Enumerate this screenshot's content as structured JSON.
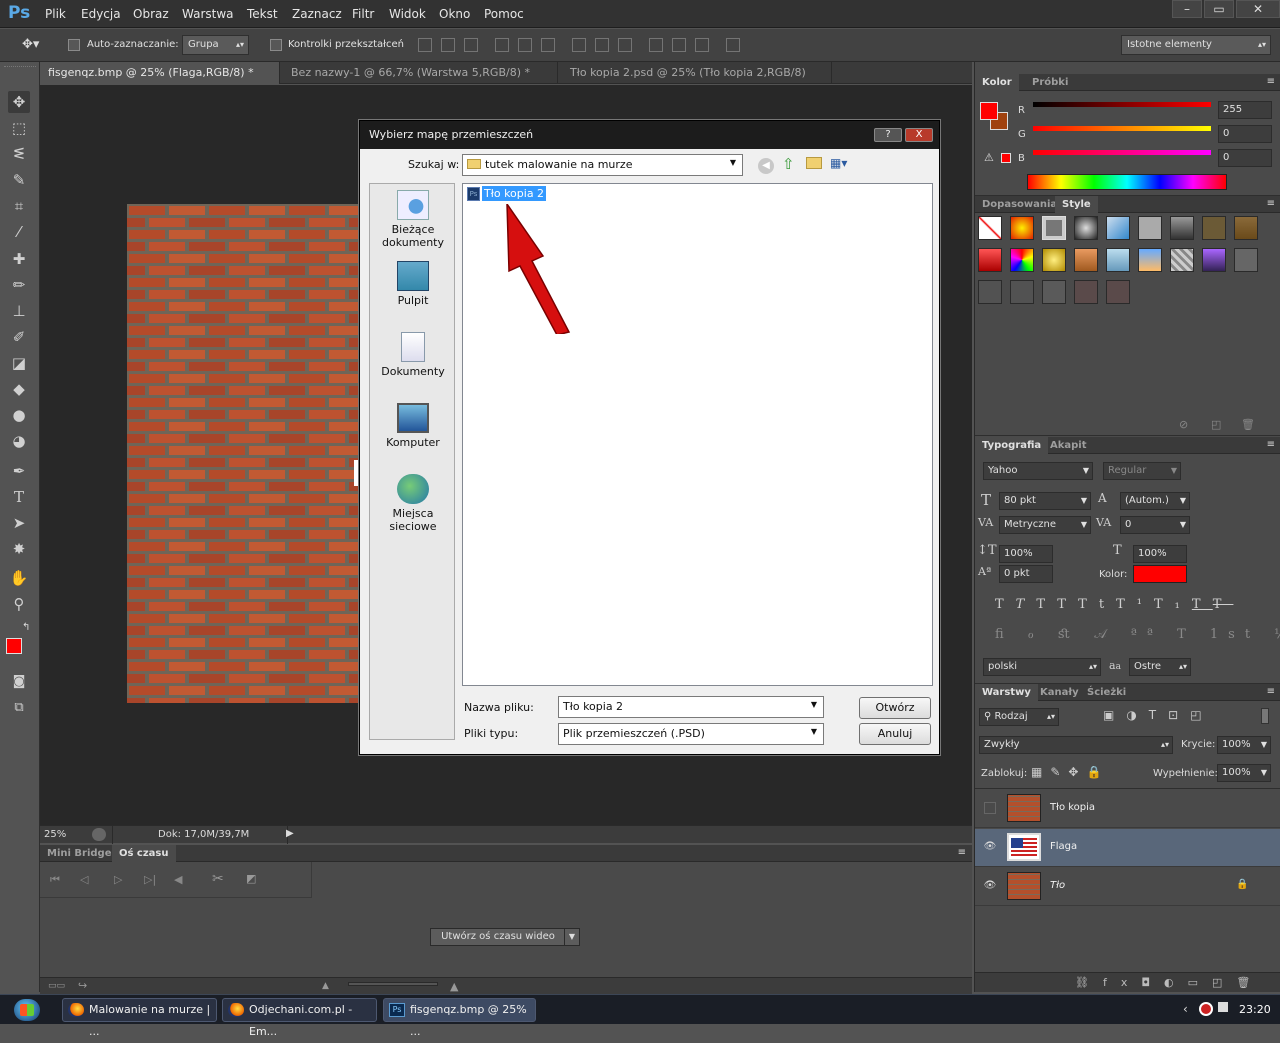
{
  "app": {
    "logo": "Ps",
    "menu": [
      "Plik",
      "Edycja",
      "Obraz",
      "Warstwa",
      "Tekst",
      "Zaznacz",
      "Filtr",
      "Widok",
      "Okno",
      "Pomoc"
    ],
    "window_buttons": [
      "–",
      "▭",
      "✕"
    ]
  },
  "options_bar": {
    "auto_select_label": "Auto-zaznaczanie:",
    "auto_select_value": "Grupa",
    "transform_controls_label": "Kontrolki przekształceń",
    "workspace": "Istotne elementy"
  },
  "doc_tabs": [
    {
      "label": "fisgenqz.bmp @ 25% (Flaga,RGB/8) *",
      "active": true
    },
    {
      "label": "Bez nazwy-1 @ 66,7% (Warstwa 5,RGB/8) *",
      "active": false
    },
    {
      "label": "Tło kopia 2.psd @ 25% (Tło kopia 2,RGB/8)",
      "active": false
    }
  ],
  "status": {
    "zoom": "25%",
    "doc": "Dok: 17,0M/39,7M"
  },
  "timeline": {
    "tabs": [
      "Mini Bridge",
      "Oś czasu"
    ],
    "create_button": "Utwórz oś czasu wideo"
  },
  "color_panel": {
    "tabs": [
      "Kolor",
      "Próbki"
    ],
    "channels": [
      {
        "name": "R",
        "value": "255"
      },
      {
        "name": "G",
        "value": "0"
      },
      {
        "name": "B",
        "value": "0"
      }
    ],
    "foreground": "#ff0000",
    "background": "#a0420f"
  },
  "styles_panel": {
    "tabs": [
      "Dopasowania",
      "Style"
    ]
  },
  "typography_panel": {
    "tabs": [
      "Typografia",
      "Akapit"
    ],
    "font_family": "Yahoo",
    "font_style": "Regular",
    "font_size": "80 pkt",
    "leading": "(Autom.)",
    "kerning": "Metryczne",
    "tracking": "0",
    "vertical_scale": "100%",
    "horizontal_scale": "100%",
    "baseline_shift": "0 pkt",
    "color_label": "Kolor:",
    "color": "#ff0000",
    "language": "polski",
    "antialias_label": "a",
    "antialias": "Ostre"
  },
  "layers_panel": {
    "tabs": [
      "Warstwy",
      "Kanały",
      "Ścieżki"
    ],
    "filter": "Rodzaj",
    "blend_mode": "Zwykły",
    "opacity_label": "Krycie:",
    "opacity": "100%",
    "lock_label": "Zablokuj:",
    "fill_label": "Wypełnienie:",
    "fill": "100%",
    "layers": [
      {
        "name": "Tło kopia",
        "visible": false,
        "selected": false,
        "locked": false
      },
      {
        "name": "Flaga",
        "visible": true,
        "selected": true,
        "locked": false
      },
      {
        "name": "Tło",
        "visible": true,
        "selected": false,
        "locked": true
      }
    ]
  },
  "dialog": {
    "title": "Wybierz mapę przemieszczeń",
    "help_button": "?",
    "close_button": "X",
    "look_in_label": "Szukaj w:",
    "look_in_value": "tutek malowanie na murze",
    "places": [
      "Bieżące dokumenty",
      "Pulpit",
      "Dokumenty",
      "Komputer",
      "Miejsca sieciowe"
    ],
    "files": [
      {
        "name": "Tło kopia 2",
        "selected": true
      }
    ],
    "file_name_label": "Nazwa pliku:",
    "file_name_value": "Tło kopia 2",
    "file_type_label": "Pliki typu:",
    "file_type_value": "Plik przemieszczeń (.PSD)",
    "open_button": "Otwórz",
    "cancel_button": "Anuluj"
  },
  "taskbar": {
    "items": [
      {
        "label": "Malowanie na murze | ...",
        "icon": "firefox-icon"
      },
      {
        "label": "Odjechani.com.pl - Em...",
        "icon": "firefox-icon"
      },
      {
        "label": "fisgenqz.bmp @ 25% ...",
        "icon": "photoshop-icon",
        "active": true
      }
    ],
    "clock": "23:20"
  }
}
